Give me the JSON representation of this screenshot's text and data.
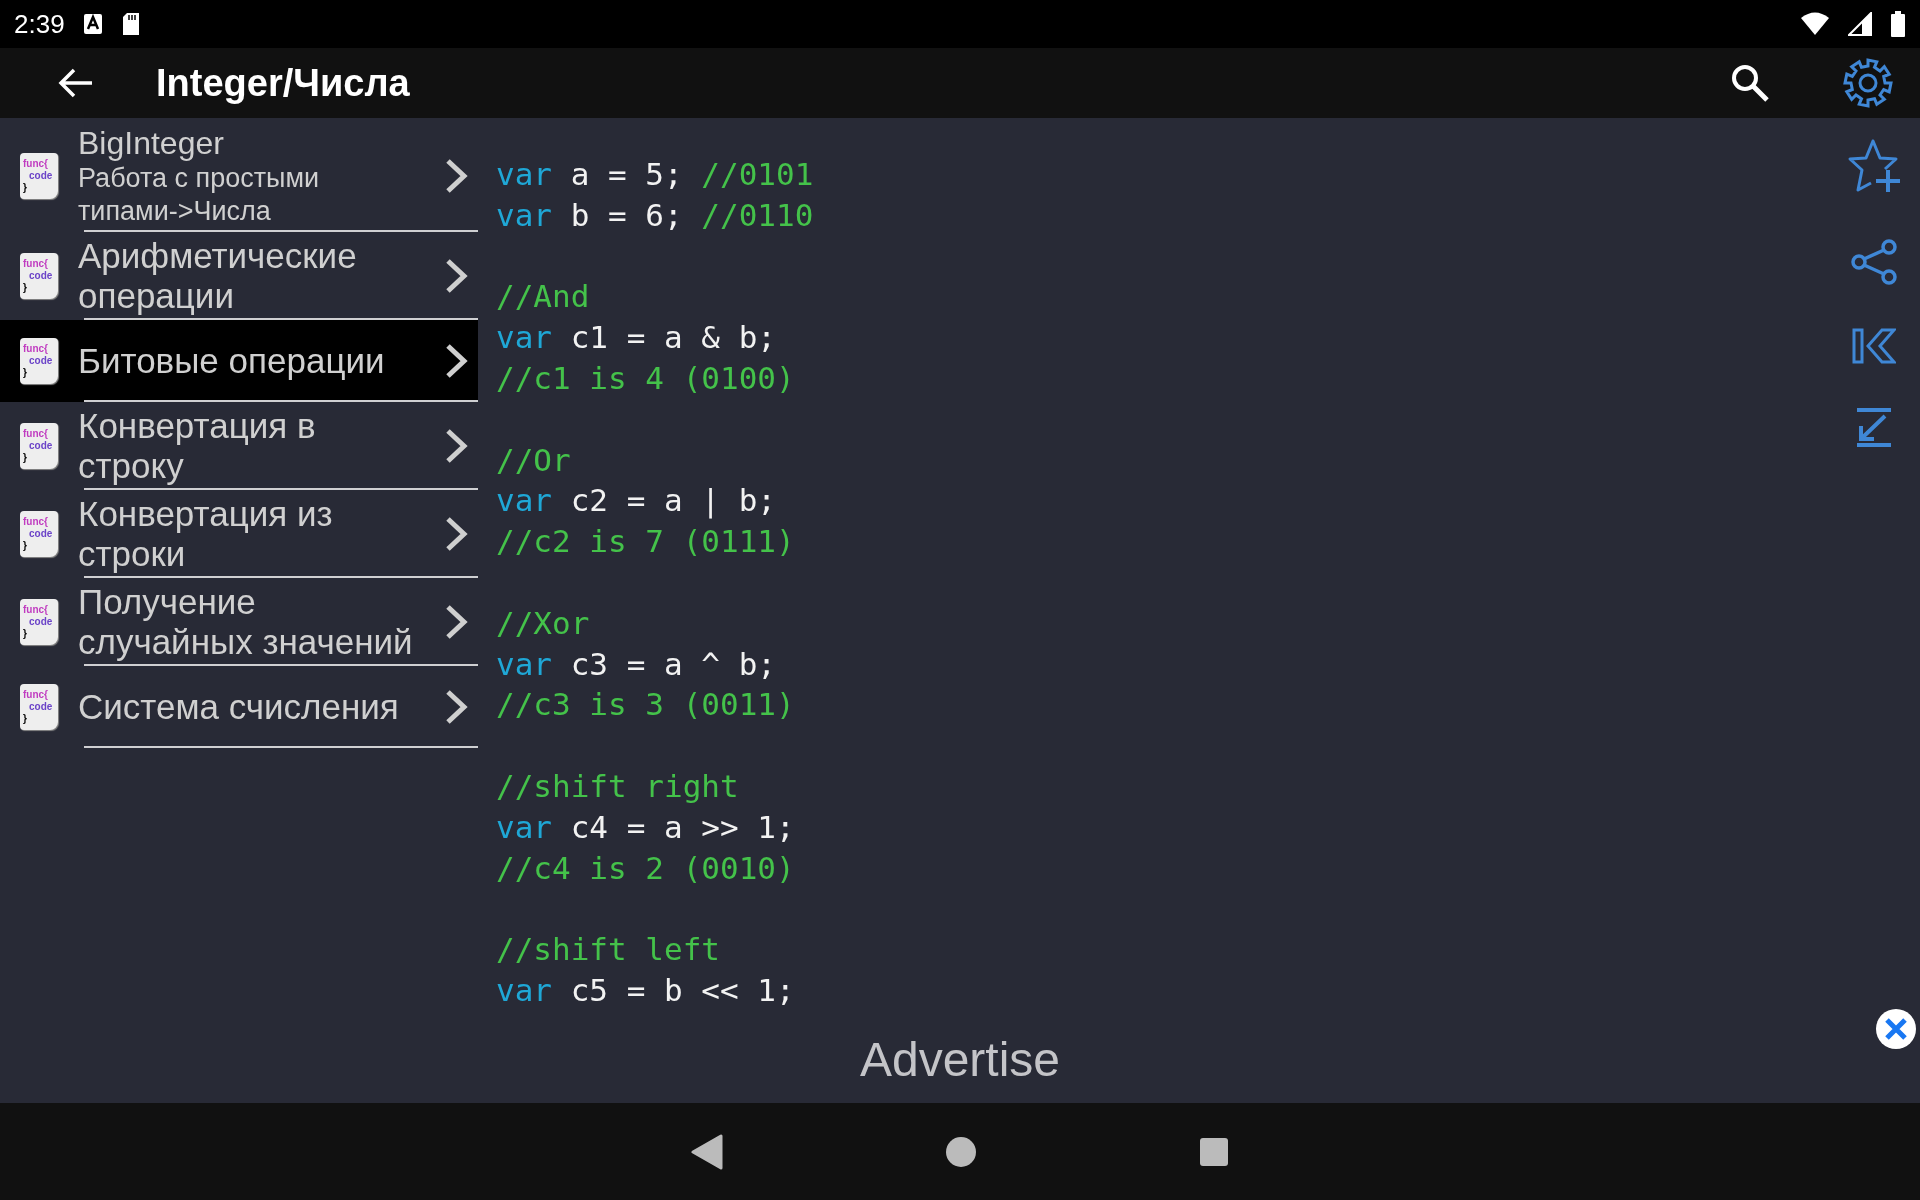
{
  "status_bar": {
    "time": "2:39"
  },
  "app_bar": {
    "title": "Integer/Числа"
  },
  "items": [
    {
      "title": "BigInteger",
      "subtitle": "Работа с простыми типами->Числа",
      "selected": false,
      "icon_lines": [
        "func{",
        "code",
        "}"
      ]
    },
    {
      "title": "Арифметические операции",
      "selected": false,
      "icon_lines": [
        "func{",
        "code",
        "}"
      ]
    },
    {
      "title": "Битовые операции",
      "selected": true,
      "icon_lines": [
        "func{",
        "code",
        "}"
      ]
    },
    {
      "title": "Конвертация в строку",
      "selected": false,
      "icon_lines": [
        "func{",
        "code",
        "}"
      ]
    },
    {
      "title": "Конвертация из строки",
      "selected": false,
      "icon_lines": [
        "func{",
        "code",
        "}"
      ]
    },
    {
      "title": "Получение случайных значений",
      "selected": false,
      "icon_lines": [
        "func{",
        "code",
        "}"
      ]
    },
    {
      "title": "Система счисления",
      "selected": false,
      "icon_lines": [
        "func{",
        "code",
        "}"
      ]
    }
  ],
  "code": [
    {
      "kind": "code",
      "keyword": "var",
      "text": "a = 5;",
      "comment": "//0101"
    },
    {
      "kind": "code",
      "keyword": "var",
      "text": "b = 6;",
      "comment": "//0110"
    },
    {
      "kind": "blank"
    },
    {
      "kind": "comment",
      "text": "//And"
    },
    {
      "kind": "code",
      "keyword": "var",
      "text": "c1 = a & b;"
    },
    {
      "kind": "comment",
      "text": "//c1 is 4 (0100)"
    },
    {
      "kind": "blank"
    },
    {
      "kind": "comment",
      "text": "//Or"
    },
    {
      "kind": "code",
      "keyword": "var",
      "text": "c2 = a | b;"
    },
    {
      "kind": "comment",
      "text": "//c2 is 7 (0111)"
    },
    {
      "kind": "blank"
    },
    {
      "kind": "comment",
      "text": "//Xor"
    },
    {
      "kind": "code",
      "keyword": "var",
      "text": "c3 = a ^ b;"
    },
    {
      "kind": "comment",
      "text": "//c3 is 3 (0011)"
    },
    {
      "kind": "blank"
    },
    {
      "kind": "comment",
      "text": "//shift right"
    },
    {
      "kind": "code",
      "keyword": "var",
      "text": "c4 = a >> 1;"
    },
    {
      "kind": "comment",
      "text": "//c4 is 2 (0010)"
    },
    {
      "kind": "blank"
    },
    {
      "kind": "comment",
      "text": "//shift left"
    },
    {
      "kind": "code",
      "keyword": "var",
      "text": "c5 = b << 1;"
    }
  ],
  "ad": {
    "text": "Advertise"
  }
}
